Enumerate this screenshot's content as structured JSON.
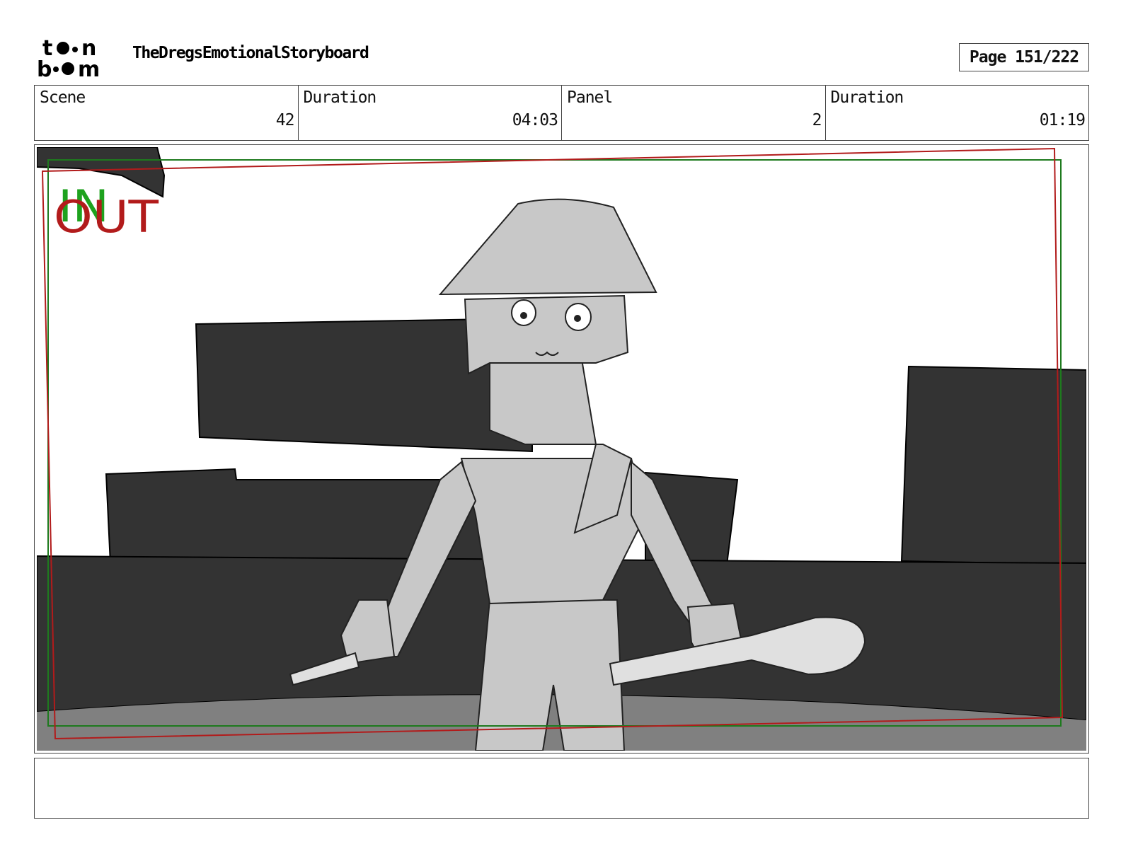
{
  "header": {
    "project_title": "TheDregsEmotionalStoryboard",
    "page_label": "Page 151/222",
    "logo": {
      "top_text": "toon",
      "bottom_text": "boom"
    }
  },
  "info": {
    "scene_label": "Scene",
    "scene_value": "42",
    "scene_duration_label": "Duration",
    "scene_duration_value": "04:03",
    "panel_label": "Panel",
    "panel_value": "2",
    "panel_duration_label": "Duration",
    "panel_duration_value": "01:19"
  },
  "panel": {
    "in_marker": "IN",
    "out_marker": "OUT",
    "colors": {
      "in": "#1ea21e",
      "out": "#b21b1b",
      "dark_set": "#333333",
      "character": "#c8c8c8",
      "floor": "#808080"
    }
  },
  "notes": {
    "text": ""
  }
}
